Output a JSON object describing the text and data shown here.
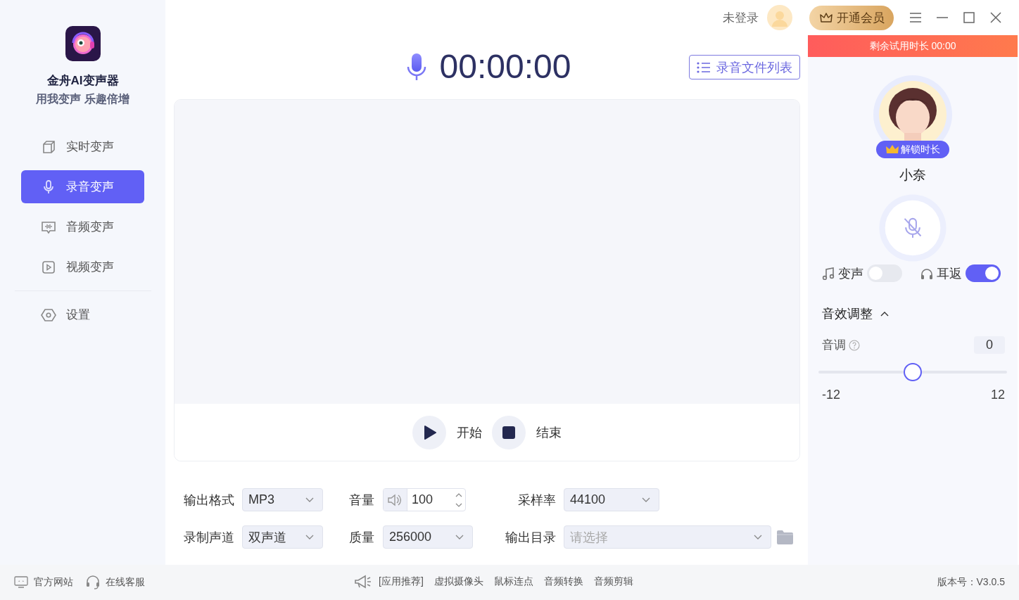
{
  "app": {
    "name": "金舟AI变声器",
    "slogan": "用我变声 乐趣倍增"
  },
  "nav": [
    {
      "label": "实时变声",
      "selected": false
    },
    {
      "label": "录音变声",
      "selected": true
    },
    {
      "label": "音频变声",
      "selected": false
    },
    {
      "label": "视频变声",
      "selected": false
    }
  ],
  "settings_item": {
    "label": "设置",
    "selected": false
  },
  "header": {
    "login_status": "未登录",
    "vip_button": "开通会员"
  },
  "recorder": {
    "timer": "00:00:00",
    "file_list_button": "录音文件列表",
    "controls": [
      {
        "kind": "play",
        "label": "开始"
      },
      {
        "kind": "stop",
        "label": "结束"
      }
    ]
  },
  "options": [
    [
      {
        "label": "输出格式",
        "kind": "select",
        "value": "MP3"
      },
      {
        "label": "音量",
        "kind": "spinner",
        "value": "100"
      },
      {
        "label": "采样率",
        "kind": "select",
        "value": "44100"
      }
    ],
    [
      {
        "label": "录制声道",
        "kind": "select",
        "value": "双声道"
      },
      {
        "label": "质量",
        "kind": "select",
        "value": "256000"
      },
      {
        "label": "输出目录",
        "kind": "folder",
        "placeholder": "请选择"
      }
    ]
  ],
  "voice_panel": {
    "trial_banner": "剩余试用时长 00:00",
    "unlock_badge": "解锁时长",
    "voice_name": "小奈",
    "mic_muted": true,
    "toggles": [
      {
        "label": "变声",
        "on": false
      },
      {
        "label": "耳返",
        "on": true
      }
    ],
    "effects": {
      "title": "音效调整",
      "expanded": true,
      "pitch": {
        "label": "音调",
        "value": "0",
        "level": 0.5,
        "min": "-12",
        "max": "12"
      }
    }
  },
  "footer": {
    "links": [
      "官方网站",
      "在线客服"
    ],
    "promo_label": "[应用推荐]",
    "promo_items": [
      "虚拟摄像头",
      "鼠标连点",
      "音频转换",
      "音频剪辑"
    ],
    "version": "版本号：V3.0.5"
  }
}
